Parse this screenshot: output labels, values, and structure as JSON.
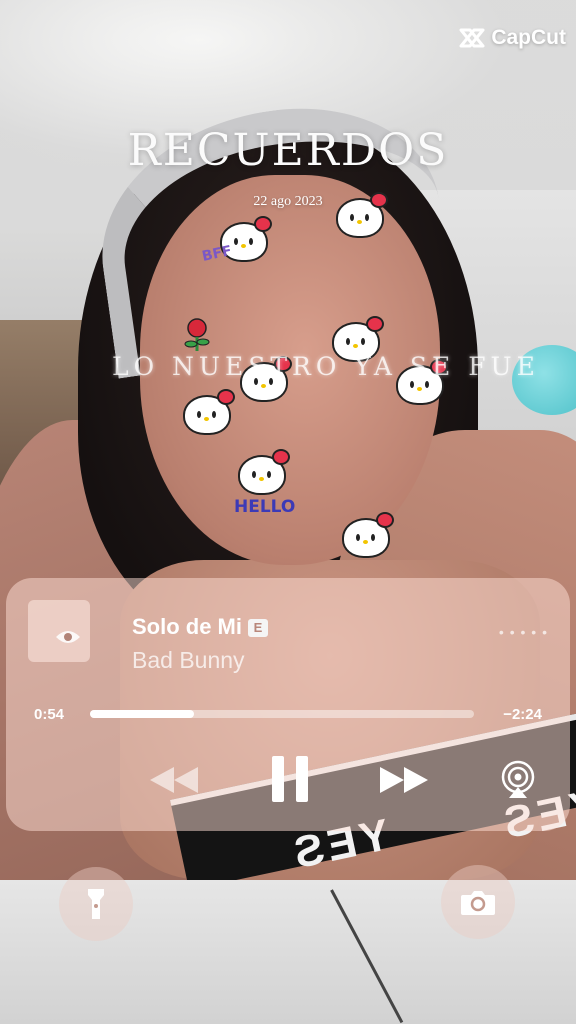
{
  "watermark": {
    "brand": "CapCut",
    "icon": "capcut-logo-icon"
  },
  "overlay": {
    "title": "RECUERDOS",
    "date": "22 ago 2023",
    "lyric": "LO NUESTRO YA SE FUE"
  },
  "stickers": {
    "hello": "HELLO",
    "bff": "BFF"
  },
  "shirt": {
    "brand": "YES"
  },
  "player": {
    "song_title": "Solo de Mi",
    "explicit_badge": "E",
    "artist": "Bad Bunny",
    "more_icon": "more-dots-icon",
    "time_elapsed": "0:54",
    "time_remaining": "−2:24",
    "progress": 0.27,
    "controls": [
      "rewind-icon",
      "pause-icon",
      "fast-forward-icon",
      "airplay-icon"
    ]
  },
  "lockscreen": {
    "left_button_icon": "flashlight-icon",
    "right_button_icon": "camera-icon"
  },
  "colors": {
    "player_bg": "#ffe0d6",
    "text": "#ffffff",
    "accent_band": "#141414"
  }
}
